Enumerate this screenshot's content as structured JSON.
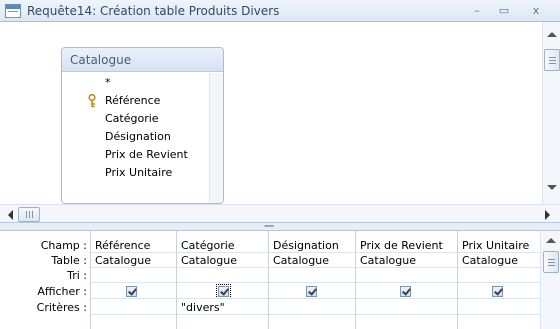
{
  "window": {
    "title": "Requête14: Création table Produits Divers",
    "min_label": "–",
    "max_label": "▭",
    "close_label": "x"
  },
  "table_box": {
    "name": "Catalogue",
    "fields": [
      "*",
      "Référence",
      "Catégorie",
      "Désignation",
      "Prix de Revient",
      "Prix Unitaire"
    ],
    "primary_key_field": "Référence"
  },
  "grid": {
    "row_labels": [
      "Champ :",
      "Table :",
      "Tri :",
      "Afficher :",
      "Critères :"
    ],
    "columns": [
      {
        "champ": "Référence",
        "table": "Catalogue",
        "tri": "",
        "afficher": true,
        "criteres": ""
      },
      {
        "champ": "Catégorie",
        "table": "Catalogue",
        "tri": "",
        "afficher": true,
        "criteres": "\"divers\""
      },
      {
        "champ": "Désignation",
        "table": "Catalogue",
        "tri": "",
        "afficher": true,
        "criteres": ""
      },
      {
        "champ": "Prix de Revient",
        "table": "Catalogue",
        "tri": "",
        "afficher": true,
        "criteres": ""
      },
      {
        "champ": "Prix Unitaire",
        "table": "Catalogue",
        "tri": "",
        "afficher": true,
        "criteres": ""
      }
    ]
  },
  "splitter": {
    "grip": "''''''''''"
  }
}
